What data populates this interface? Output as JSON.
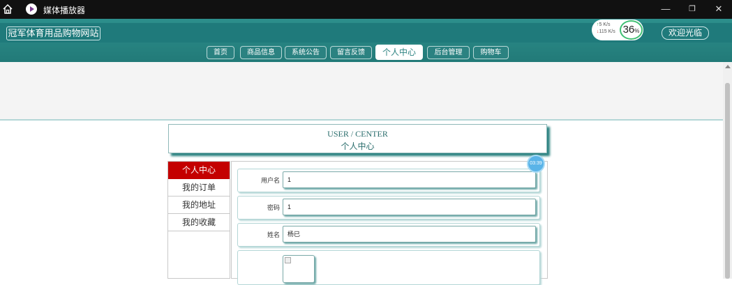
{
  "window": {
    "title": "媒体播放器",
    "controls": {
      "minimize": "—",
      "maximize": "❐",
      "close": "✕"
    }
  },
  "header": {
    "site_name": "冠军体育用品购物网站",
    "welcome": "欢迎光临",
    "speed_widget": {
      "up": "5  K/s",
      "down": "115 K/s",
      "percent": "36",
      "percent_unit": "%"
    }
  },
  "nav": {
    "items": [
      {
        "label": "首页",
        "active": false
      },
      {
        "label": "商品信息",
        "active": false
      },
      {
        "label": "系统公告",
        "active": false
      },
      {
        "label": "留言反馈",
        "active": false
      },
      {
        "label": "个人中心",
        "active": true
      },
      {
        "label": "后台管理",
        "active": false
      },
      {
        "label": "购物车",
        "active": false
      }
    ]
  },
  "center_heading": {
    "english": "USER / CENTER",
    "chinese": "个人中心"
  },
  "timer_badge": "03:39",
  "sidebar": {
    "items": [
      {
        "label": "个人中心",
        "active": true
      },
      {
        "label": "我的订单",
        "active": false
      },
      {
        "label": "我的地址",
        "active": false
      },
      {
        "label": "我的收藏",
        "active": false
      }
    ]
  },
  "form": {
    "fields": [
      {
        "label": "用户名",
        "value": "1"
      },
      {
        "label": "密码",
        "value": "1"
      },
      {
        "label": "姓名",
        "value": "杨已"
      }
    ]
  },
  "colors": {
    "accent": "#2b8281",
    "active_sidebar": "#c40000",
    "titlebar": "#111111"
  }
}
